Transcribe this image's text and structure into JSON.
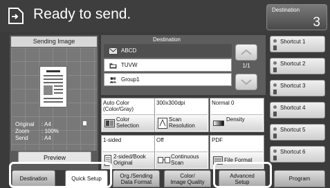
{
  "header": {
    "title": "Ready to send.",
    "destination_label": "Destination",
    "destination_count": "3"
  },
  "sending_image": {
    "title": "Sending Image",
    "info": [
      {
        "label": "Original",
        "value": ": A4"
      },
      {
        "label": "Zoom",
        "value": ": 100%"
      },
      {
        "label": "Send",
        "value": ": A4"
      }
    ],
    "preview_label": "Preview"
  },
  "destination_panel": {
    "title": "Destination",
    "rows": [
      {
        "label": "ABCD",
        "icon": "email-icon"
      },
      {
        "label": "TUVW",
        "icon": "folder-icon"
      },
      {
        "label": "Group1",
        "icon": "group-icon"
      }
    ],
    "page_indicator": "1/1"
  },
  "settings": [
    {
      "value": "Auto Color\n(Color/Gray)",
      "label": "Color\nSelection",
      "icon": "color-icon"
    },
    {
      "value": "300x300dpi",
      "label": "Scan\nResolution",
      "icon": "resolution-icon"
    },
    {
      "value": "Normal 0",
      "label": "Density",
      "icon": "density-icon"
    },
    {
      "value": "1-sided",
      "label": "2-sided/Book\nOriginal",
      "icon": "duplex-icon"
    },
    {
      "value": "Off",
      "label": "Continuous\nScan",
      "icon": "continuous-icon"
    },
    {
      "value": "PDF",
      "label": "File Format",
      "icon": "file-icon"
    }
  ],
  "shortcuts": [
    "Shortcut 1",
    "Shortcut 2",
    "Shortcut 3",
    "Shortcut 4",
    "Shortcut 5",
    "Shortcut 6"
  ],
  "tabs": [
    {
      "label": "Destination"
    },
    {
      "label": "Quick Setup",
      "active": true
    },
    {
      "label": "Org./Sending\nData Format"
    },
    {
      "label": "Color/\nImage Quality"
    },
    {
      "label": "Advanced\nSetup"
    },
    {
      "label": "Program"
    }
  ],
  "colors": {
    "background": "#3b3b3b",
    "highlight": "#ffffff"
  }
}
